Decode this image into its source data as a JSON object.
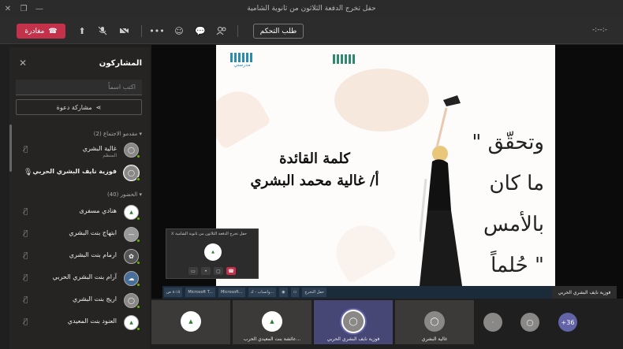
{
  "window": {
    "title": "حفل تخرج الدفعة الثلاثون من ثانوية الشامية"
  },
  "toolbar": {
    "leave_label": "مغادرة",
    "request_control_label": "طلب التحكم",
    "timer": "-:--:-",
    "accent": "#c4314b"
  },
  "panel": {
    "title": "المشاركون",
    "search_placeholder": "اكتب اسماً",
    "share_invite_label": "مشاركة دعوة",
    "presenters_heading": "مقدمو الاجتماع (2)",
    "attendees_heading": "الحضور (40)",
    "presenters": [
      {
        "name": "غالية البشري",
        "role": "المنظم",
        "mic": "muted"
      },
      {
        "name": "فوزية نايف البشري الحربي",
        "role": "",
        "mic": "on"
      }
    ],
    "attendees": [
      {
        "name": "هنادي مسفرى"
      },
      {
        "name": "ابتهاج بنت البشري"
      },
      {
        "name": "ارمام بنت البشري"
      },
      {
        "name": "آرام بنت البشري الحربي"
      },
      {
        "name": "اريج بنت البشري"
      },
      {
        "name": "العنود بنت المعيدي"
      }
    ]
  },
  "slide": {
    "title": "كلمة القائدة",
    "speaker": "أ/ غالية محمد البشري",
    "quote": [
      "\" وتحقّق",
      "ما كان",
      "بالأمس",
      "حُلماً \""
    ],
    "logo_left": "مدرستي",
    "taskbar_items": [
      "حفل التخرج",
      "واتساب - ك...",
      "Microsoft...",
      "Microsoft T..."
    ],
    "clock": "٨:١٥ ص"
  },
  "presenter_tag": "فوزية نايف البشري الحربي",
  "mini_window": {
    "title": "حفل تخرج الدفعة الثلاثون من ثانوية الشامية"
  },
  "tiles": [
    {
      "name": ""
    },
    {
      "name": "عائشة بنت المعيدي الحرب..."
    },
    {
      "name": "فوزية نايف البشري الحربي"
    },
    {
      "name": "غالية البشري"
    }
  ],
  "overflow_count": "+36"
}
